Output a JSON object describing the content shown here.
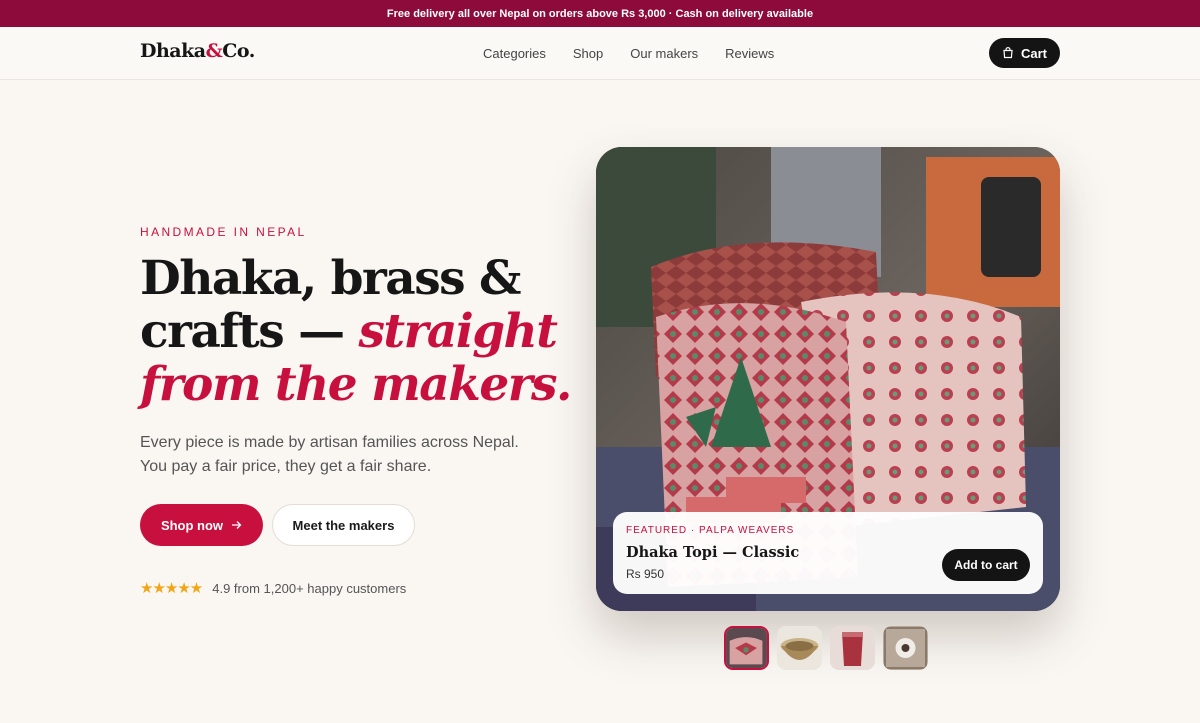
{
  "promo_bar": {
    "text": "Free delivery all over Nepal on orders above Rs 3,000 · Cash on delivery available"
  },
  "brand": {
    "name_part1": "Dhaka",
    "ampersand": "&",
    "name_part2": "Co."
  },
  "nav": {
    "items": [
      "Categories",
      "Shop",
      "Our makers",
      "Reviews"
    ],
    "cart_label": "Cart"
  },
  "hero": {
    "eyebrow": "HANDMADE IN NEPAL",
    "headline_line1": "Dhaka, brass &",
    "headline_line2": "crafts — ",
    "headline_accent1": "straight",
    "headline_accent2": "from the makers.",
    "lead": "Every piece is made by artisan families across Nepal. You pay a fair price, they get a fair share.",
    "primary_cta": "Shop now",
    "secondary_cta": "Meet the makers",
    "rating": {
      "stars": "★★★★★",
      "text": "4.9 from 1,200+ happy customers"
    }
  },
  "featured": {
    "tag": "FEATURED · PALPA WEAVERS",
    "name": "Dhaka Topi — Classic",
    "price": "Rs 950",
    "cta": "Add to cart"
  },
  "thumbnails": [
    {
      "name": "dhaka-topi-thumb",
      "active": true
    },
    {
      "name": "brass-bowl-thumb",
      "active": false
    },
    {
      "name": "red-glass-thumb",
      "active": false
    },
    {
      "name": "carved-panel-thumb",
      "active": false
    }
  ],
  "colors": {
    "accent": "#c8103e",
    "promo_bg": "#8c0b3a",
    "dark": "#141414",
    "page_bg": "#faf7f3",
    "star": "#f2a516"
  }
}
